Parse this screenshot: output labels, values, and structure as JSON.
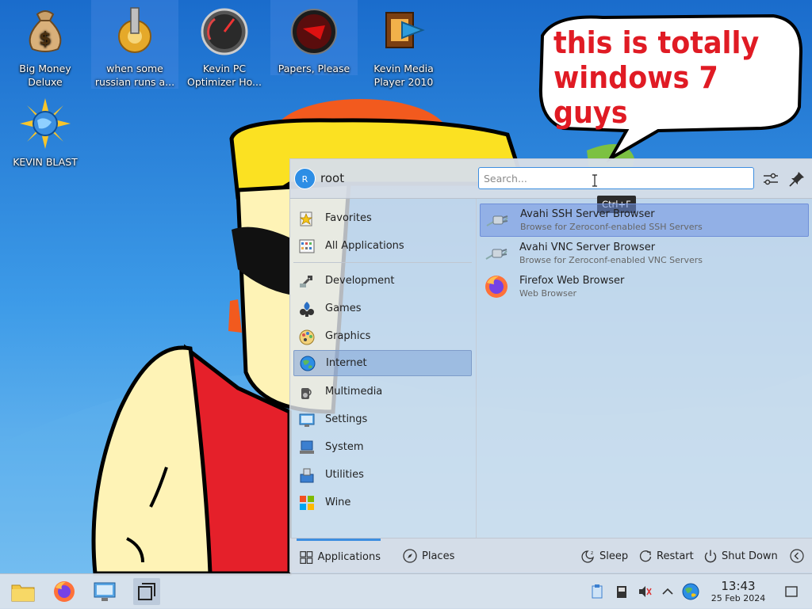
{
  "desktop": {
    "icons": [
      {
        "label": "Big Money\nDeluxe"
      },
      {
        "label": "when some\nrussian runs a..."
      },
      {
        "label": "Kevin PC\nOptimizer Ho..."
      },
      {
        "label": "Papers, Please"
      },
      {
        "label": "Kevin Media\nPlayer 2010"
      },
      {
        "label": "KEVIN BLAST"
      }
    ],
    "bubble_text": "this is totally\nwindows 7 guys"
  },
  "launcher": {
    "user": {
      "initial": "R",
      "name": "root"
    },
    "search": {
      "placeholder": "Search...",
      "value": "",
      "tooltip": "Ctrl+F"
    },
    "categories": [
      {
        "label": "Favorites",
        "icon": "favorites-icon"
      },
      {
        "label": "All Applications",
        "icon": "all-apps-icon"
      },
      {
        "label": "Development",
        "icon": "development-icon"
      },
      {
        "label": "Games",
        "icon": "games-icon"
      },
      {
        "label": "Graphics",
        "icon": "graphics-icon"
      },
      {
        "label": "Internet",
        "icon": "internet-icon",
        "selected": true
      },
      {
        "label": "Multimedia",
        "icon": "multimedia-icon"
      },
      {
        "label": "Settings",
        "icon": "settings-icon"
      },
      {
        "label": "System",
        "icon": "system-icon"
      },
      {
        "label": "Utilities",
        "icon": "utilities-icon"
      },
      {
        "label": "Wine",
        "icon": "wine-icon"
      }
    ],
    "results": [
      {
        "title": "Avahi SSH Server Browser",
        "subtitle": "Browse for Zeroconf-enabled SSH Servers",
        "selected": true
      },
      {
        "title": "Avahi VNC Server Browser",
        "subtitle": "Browse for Zeroconf-enabled VNC Servers"
      },
      {
        "title": "Firefox Web Browser",
        "subtitle": "Web Browser"
      }
    ],
    "footer": {
      "tabs": [
        {
          "label": "Applications",
          "active": true
        },
        {
          "label": "Places"
        }
      ],
      "power": [
        {
          "label": "Sleep"
        },
        {
          "label": "Restart"
        },
        {
          "label": "Shut Down"
        }
      ]
    }
  },
  "taskbar": {
    "clock": {
      "time": "13:43",
      "date": "25 Feb 2024"
    }
  },
  "colors": {
    "accent": "#3d8ee0",
    "selection": "#6f8fd8",
    "bubble_text": "#e01b24"
  }
}
